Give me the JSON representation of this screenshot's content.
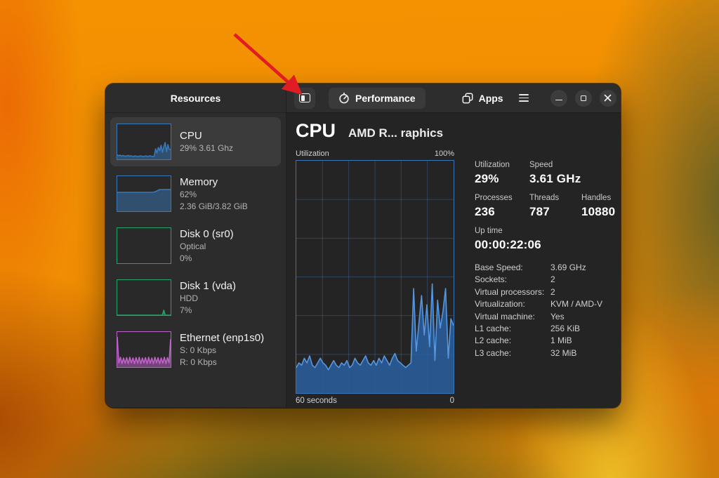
{
  "window": {
    "title": "Resources"
  },
  "header": {
    "sidebar_toggle_icon": "split-panel",
    "tabs": [
      {
        "label": "Performance",
        "icon": "speedometer-icon",
        "selected": true
      },
      {
        "label": "Apps",
        "icon": "stacked-windows-icon",
        "selected": false
      }
    ],
    "menu_icon": "hamburger-menu",
    "window_controls": [
      "minimize",
      "maximize",
      "close"
    ]
  },
  "sidebar": {
    "items": [
      {
        "id": "cpu",
        "name": "CPU",
        "lines": [
          "29% 3.61 Ghz"
        ],
        "accent": "#3a78b8",
        "selected": true
      },
      {
        "id": "memory",
        "name": "Memory",
        "lines": [
          "62%",
          "2.36 GiB/3.82 GiB"
        ],
        "accent": "#3a78b8",
        "selected": false
      },
      {
        "id": "disk0",
        "name": "Disk 0 (sr0)",
        "lines": [
          "Optical",
          "0%"
        ],
        "accent": "#26a269",
        "selected": false
      },
      {
        "id": "disk1",
        "name": "Disk 1 (vda)",
        "lines": [
          "HDD",
          "7%"
        ],
        "accent": "#26a269",
        "selected": false
      },
      {
        "id": "ethernet",
        "name": "Ethernet (enp1s0)",
        "lines": [
          "S: 0 Kbps",
          "R: 0 Kbps"
        ],
        "accent": "#c061cb",
        "selected": false
      }
    ]
  },
  "main": {
    "title": "CPU",
    "subtitle": "AMD R... raphics",
    "graph_labels": {
      "top_left": "Utilization",
      "top_right": "100%",
      "bottom_left": "60 seconds",
      "bottom_right": "0"
    },
    "stat_groups": [
      [
        {
          "label": "Utilization",
          "value": "29%"
        },
        {
          "label": "Speed",
          "value": "3.61 GHz"
        }
      ],
      [
        {
          "label": "Processes",
          "value": "236"
        },
        {
          "label": "Threads",
          "value": "787"
        },
        {
          "label": "Handles",
          "value": "10880"
        }
      ],
      [
        {
          "label": "Up time",
          "value": "00:00:22:06"
        }
      ]
    ],
    "details": [
      {
        "label": "Base Speed:",
        "value": "3.69 GHz"
      },
      {
        "label": "Sockets:",
        "value": "2"
      },
      {
        "label": "Virtual processors:",
        "value": "2"
      },
      {
        "label": "Virtualization:",
        "value": "KVM / AMD-V"
      },
      {
        "label": "Virtual machine:",
        "value": "Yes"
      },
      {
        "label": "L1 cache:",
        "value": "256 KiB"
      },
      {
        "label": "L2 cache:",
        "value": "1 MiB"
      },
      {
        "label": "L3 cache:",
        "value": "32 MiB"
      }
    ]
  },
  "chart_data": {
    "type": "area",
    "title": "CPU Utilization over last 60 seconds",
    "xlabel": "seconds ago (60 → 0)",
    "ylabel": "Utilization %",
    "ylim": [
      0,
      100
    ],
    "grid": true,
    "grid_divisions": 6,
    "series": [
      {
        "name": "utilization_percent",
        "values": [
          11,
          13,
          12,
          15,
          13,
          16,
          12,
          11,
          13,
          15,
          13,
          12,
          10,
          12,
          14,
          12,
          11,
          13,
          12,
          14,
          11,
          12,
          15,
          13,
          12,
          14,
          16,
          13,
          12,
          14,
          12,
          15,
          13,
          16,
          14,
          12,
          15,
          17,
          14,
          13,
          12,
          11,
          12,
          13,
          45,
          18,
          30,
          42,
          25,
          38,
          20,
          47,
          14,
          40,
          28,
          35,
          45,
          15,
          32,
          29
        ]
      }
    ],
    "colors": {
      "stroke": "#5796dd",
      "fill": "rgba(42,95,160,0.85)",
      "grid": "rgba(82,148,226,0.28)",
      "border": "#3a76b5"
    },
    "thumbnails": {
      "cpu": [
        13,
        10,
        12,
        9,
        11,
        10,
        9,
        10,
        11,
        9,
        10,
        9,
        8,
        10,
        9,
        8,
        9,
        10,
        9,
        8,
        9,
        10,
        8,
        9,
        10,
        9,
        8,
        9,
        30,
        18,
        34,
        24,
        40,
        20,
        36,
        48,
        22,
        42,
        28,
        28
      ],
      "memory": [
        54,
        54,
        54,
        54,
        54,
        54,
        54,
        54,
        54,
        54,
        54,
        54,
        54,
        54,
        54,
        54,
        54,
        54,
        54,
        54,
        54,
        54,
        54,
        54,
        54,
        54,
        54,
        55,
        56,
        58,
        60,
        62,
        62,
        62,
        62,
        62,
        62,
        62,
        62,
        62
      ],
      "disk0": [
        0,
        0,
        0,
        0,
        0,
        0,
        0,
        0,
        0,
        0,
        0,
        0,
        0,
        0,
        0,
        0,
        0,
        0,
        0,
        0,
        0,
        0,
        0,
        0,
        0,
        0,
        0,
        0,
        0,
        0,
        0,
        0,
        0,
        0,
        0,
        0,
        0,
        0,
        0,
        0
      ],
      "disk1": [
        0,
        0,
        0,
        0,
        0,
        0,
        0,
        0,
        0,
        0,
        0,
        0,
        0,
        0,
        0,
        0,
        0,
        0,
        0,
        0,
        0,
        0,
        0,
        0,
        0,
        0,
        0,
        0,
        0,
        0,
        0,
        0,
        0,
        0,
        14,
        0,
        0,
        0,
        0,
        0
      ],
      "ethernet": [
        86,
        12,
        28,
        10,
        26,
        11,
        27,
        10,
        28,
        12,
        26,
        10,
        27,
        11,
        28,
        10,
        26,
        12,
        27,
        10,
        28,
        11,
        26,
        10,
        28,
        12,
        27,
        10,
        26,
        11,
        28,
        10,
        27,
        12,
        80
      ]
    }
  },
  "annotation_arrow": {
    "color": "#e11c24"
  }
}
